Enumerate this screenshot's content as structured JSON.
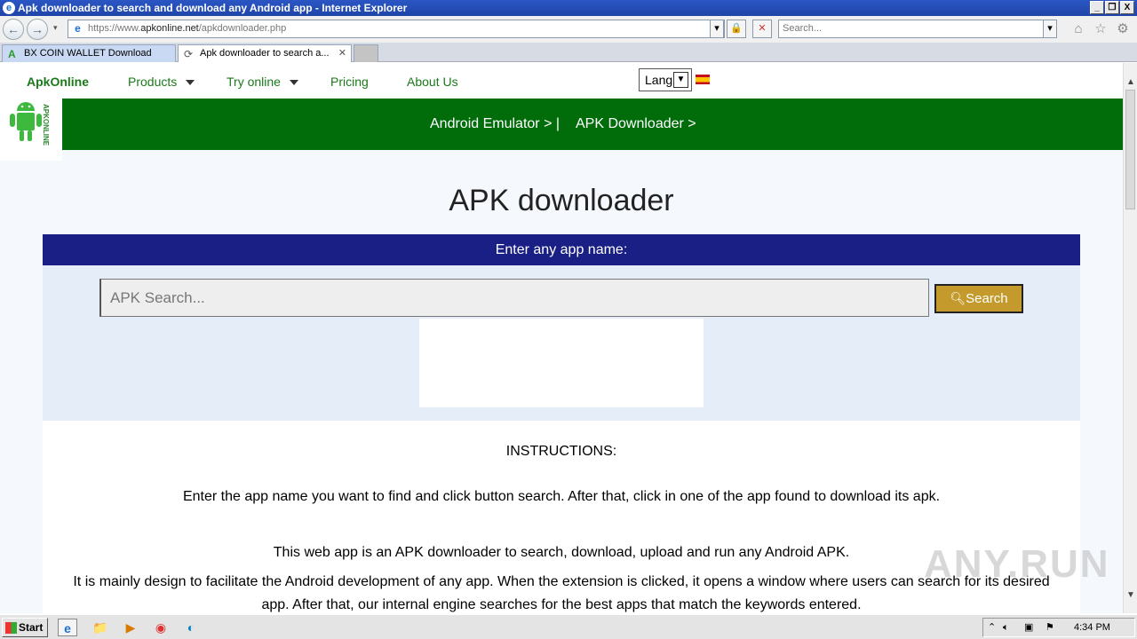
{
  "window": {
    "title": "Apk downloader to search and download any Android app - Internet Explorer",
    "controls": [
      "_",
      "❐",
      "X"
    ]
  },
  "browser": {
    "url_prefix": "https://www.",
    "url_domain": "apkonline.net",
    "url_path": "/apkdownloader.php",
    "search_placeholder": "Search...",
    "tabs": [
      {
        "label": "BX COIN WALLET Download",
        "active": false
      },
      {
        "label": "Apk downloader to search a...",
        "active": true
      }
    ]
  },
  "site": {
    "brand": "ApkOnline",
    "nav": [
      "Products",
      "Try online",
      "Pricing",
      "About Us"
    ],
    "lang_value": "Lang",
    "logo_text": "APKONLINE",
    "banner_links": [
      "Android Emulator > |",
      "APK Downloader >"
    ]
  },
  "main": {
    "heading": "APK downloader",
    "bar_label": "Enter any app name:",
    "search_placeholder": "APK Search...",
    "search_button": "Search",
    "instructions_title": "INSTRUCTIONS:",
    "instructions_text": "Enter the app name you want to find and click button search. After that, click in one of the app found to download its apk.",
    "para1": "This web app is an APK downloader to search, download, upload and run any Android APK.",
    "para2_line1": "It is mainly design to facilitate the Android development of any app. When the extension is clicked, it opens a window where users can search for its desired",
    "para2_line2": "app. After that, our internal engine searches for the best apps that match the keywords entered."
  },
  "overlay": {
    "watermark": "ANY.RUN"
  },
  "taskbar": {
    "start_label": "Start",
    "clock": "4:34 PM"
  },
  "colors": {
    "nav_green": "#1a7a1a",
    "banner_green": "#006c0a",
    "bar_blue": "#1a1f85",
    "search_gold": "#c49a2c"
  }
}
